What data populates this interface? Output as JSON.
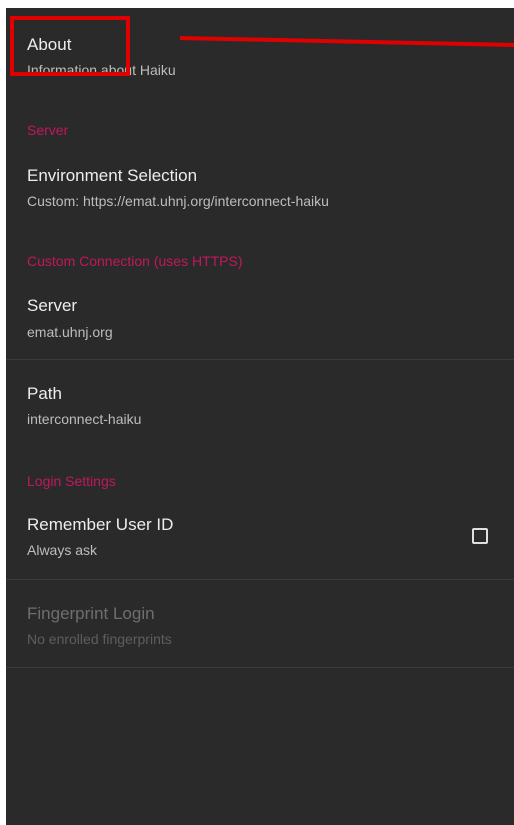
{
  "about": {
    "title": "About",
    "summary": "Information about Haiku"
  },
  "server_section": {
    "header": "Server",
    "environment": {
      "title": "Environment Selection",
      "summary": "Custom: https://emat.uhnj.org/interconnect-haiku"
    }
  },
  "custom_connection_section": {
    "header": "Custom Connection (uses HTTPS)",
    "server": {
      "title": "Server",
      "summary": "emat.uhnj.org"
    },
    "path": {
      "title": "Path",
      "summary": "interconnect-haiku"
    }
  },
  "login_section": {
    "header": "Login Settings",
    "remember_user": {
      "title": "Remember User ID",
      "summary": "Always ask",
      "checked": false
    },
    "fingerprint": {
      "title": "Fingerprint Login",
      "summary": "No enrolled fingerprints",
      "enabled": false
    }
  },
  "colors": {
    "background": "#2a2a2a",
    "accent": "#c2185b",
    "annotation": "#e00000"
  },
  "icons": {
    "checkbox": "checkbox-unchecked-icon"
  }
}
